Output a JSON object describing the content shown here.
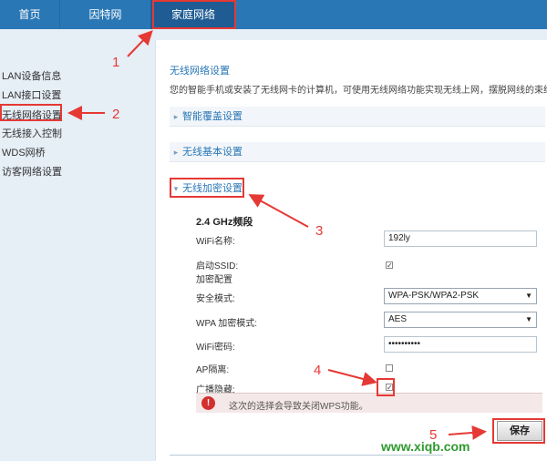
{
  "topnav": {
    "tabs": [
      {
        "label": "首页"
      },
      {
        "label": "因特网"
      },
      {
        "label": "家庭网络"
      }
    ]
  },
  "sidebar": {
    "items": [
      {
        "label": "LAN设备信息"
      },
      {
        "label": "LAN接口设置"
      },
      {
        "label": "无线网络设置"
      },
      {
        "label": "无线接入控制"
      },
      {
        "label": "WDS网桥"
      },
      {
        "label": "访客网络设置"
      }
    ]
  },
  "main": {
    "title": "无线网络设置",
    "description": "您的智能手机或安装了无线网卡的计算机，可使用无线网络功能实现无线上网，摆脱网线的束缚。",
    "sections": {
      "smart_coverage": "智能覆盖设置",
      "wireless_basic": "无线基本设置",
      "wireless_encryption": "无线加密设置"
    },
    "band_title": "2.4 GHz频段",
    "fields": {
      "wifi_name_label": "WiFi名称:",
      "wifi_name_value": "192ly",
      "enable_ssid_label": "启动SSID:",
      "encryption_config_label": "加密配置",
      "security_mode_label": "安全模式:",
      "security_mode_value": "WPA-PSK/WPA2-PSK",
      "wpa_mode_label": "WPA 加密模式:",
      "wpa_mode_value": "AES",
      "wifi_password_label": "WiFi密码:",
      "wifi_password_value": "••••••••••",
      "ap_isolation_label": "AP隔离:",
      "broadcast_hide_label": "广播隐藏:"
    },
    "warning_icon": "!",
    "warning_text": "这次的选择会导致关闭WPS功能。",
    "save_label": "保存"
  },
  "annotations": [
    "1",
    "2",
    "3",
    "4",
    "5"
  ],
  "watermark": "www.xiqb.com",
  "colors": {
    "nav": "#2a77b5",
    "accent": "#2a77b5",
    "annotation": "#e53935",
    "watermark": "#2f9a2f"
  }
}
